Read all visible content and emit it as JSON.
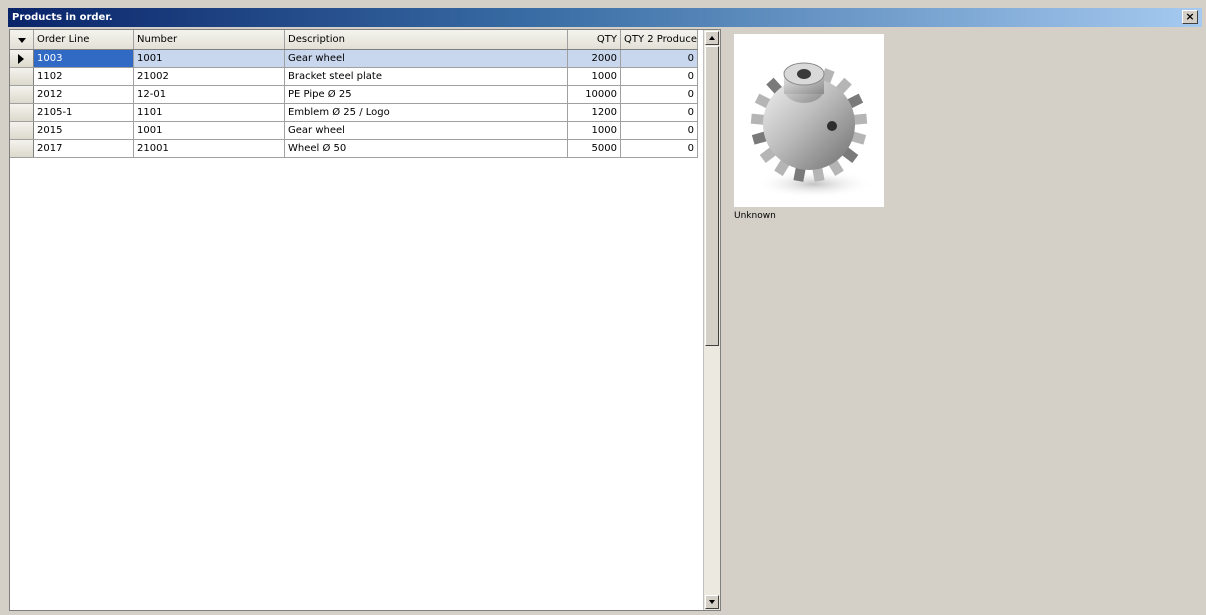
{
  "window": {
    "title": "Products in order."
  },
  "grid": {
    "columns": [
      "Order Line",
      "Number",
      "Description",
      "QTY",
      "QTY 2 Produce"
    ],
    "rows": [
      {
        "order_line": "1003",
        "number": "1001",
        "description": "Gear wheel",
        "qty": "2000",
        "qty_to_produce": "0"
      },
      {
        "order_line": "1102",
        "number": "21002",
        "description": "Bracket steel plate",
        "qty": "1000",
        "qty_to_produce": "0"
      },
      {
        "order_line": "2012",
        "number": "12-01",
        "description": "PE Pipe Ø 25",
        "qty": "10000",
        "qty_to_produce": "0"
      },
      {
        "order_line": "2105-1",
        "number": "1101",
        "description": "Emblem Ø 25 / Logo",
        "qty": "1200",
        "qty_to_produce": "0"
      },
      {
        "order_line": "2015",
        "number": "1001",
        "description": "Gear wheel",
        "qty": "1000",
        "qty_to_produce": "0"
      },
      {
        "order_line": "2017",
        "number": "21001",
        "description": "Wheel Ø 50",
        "qty": "5000",
        "qty_to_produce": "0"
      }
    ]
  },
  "preview": {
    "caption": "Unknown",
    "image": "gear-wheel-image"
  },
  "colors": {
    "title_start": "#0a246a",
    "title_end": "#a6caf0",
    "selection": "#316ac5"
  }
}
